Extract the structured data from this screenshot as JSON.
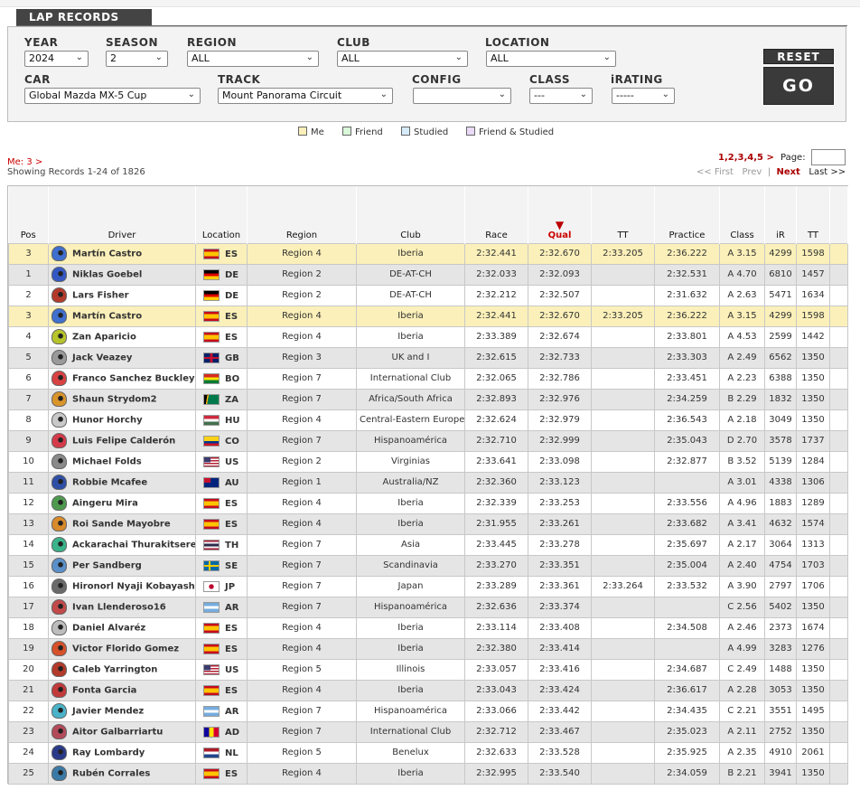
{
  "header": {
    "title": "LAP RECORDS"
  },
  "filters": {
    "year_label": "YEAR",
    "year_value": "2024",
    "season_label": "SEASON",
    "season_value": "2",
    "region_label": "REGION",
    "region_value": "ALL",
    "club_label": "CLUB",
    "club_value": "ALL",
    "location_label": "LOCATION",
    "location_value": "ALL",
    "car_label": "CAR",
    "car_value": "Global Mazda MX-5 Cup",
    "track_label": "TRACK",
    "track_value": "Mount Panorama Circuit",
    "config_label": "CONFIG",
    "config_value": "",
    "class_label": "CLASS",
    "class_value": "---",
    "irating_label": "iRATING",
    "irating_value": "-----",
    "reset_label": "RESET",
    "go_label": "GO"
  },
  "legend": [
    {
      "label": "Me",
      "color": "#fbf0b9"
    },
    {
      "label": "Friend",
      "color": "#d9f7d9"
    },
    {
      "label": "Studied",
      "color": "#d6ebfb"
    },
    {
      "label": "Friend & Studied",
      "color": "#ead9f7"
    }
  ],
  "info": {
    "me_link": "Me: 3 >",
    "showing": "Showing Records 1-24 of 1826",
    "pages": "1,2,3,4,5 >",
    "page_label": "Page:",
    "first": "<< First",
    "prev": "Prev",
    "sep": "|",
    "next": "Next",
    "last": "Last >>"
  },
  "columns": [
    "Pos",
    "Driver",
    "Location",
    "Region",
    "Club",
    "Race",
    "Qual",
    "TT",
    "Practice",
    "Class",
    "iR",
    "TT"
  ],
  "rows": [
    {
      "pos": "3",
      "driver": "Martín Castro",
      "loc": "ES",
      "region": "Region 4",
      "club": "Iberia",
      "race": "2:32.441",
      "qual": "2:32.670",
      "tt": "2:33.205",
      "practice": "2:36.222",
      "class": "A 3.15",
      "ir": "4299",
      "tt2": "1598",
      "me": true,
      "helmet": "#3f6fcf",
      "flag": "es"
    },
    {
      "pos": "1",
      "driver": "Niklas Goebel",
      "loc": "DE",
      "region": "Region 2",
      "club": "DE-AT-CH",
      "race": "2:32.033",
      "qual": "2:32.093",
      "tt": "",
      "practice": "2:32.531",
      "class": "A 4.70",
      "ir": "6810",
      "tt2": "1457",
      "helmet": "#3358c4",
      "flag": "de"
    },
    {
      "pos": "2",
      "driver": "Lars Fisher",
      "loc": "DE",
      "region": "Region 2",
      "club": "DE-AT-CH",
      "race": "2:32.212",
      "qual": "2:32.507",
      "tt": "",
      "practice": "2:31.632",
      "class": "A 2.63",
      "ir": "5471",
      "tt2": "1634",
      "helmet": "#b33a2a",
      "flag": "de"
    },
    {
      "pos": "3",
      "driver": "Martín Castro",
      "loc": "ES",
      "region": "Region 4",
      "club": "Iberia",
      "race": "2:32.441",
      "qual": "2:32.670",
      "tt": "2:33.205",
      "practice": "2:36.222",
      "class": "A 3.15",
      "ir": "4299",
      "tt2": "1598",
      "me": true,
      "helmet": "#3f6fcf",
      "flag": "es"
    },
    {
      "pos": "4",
      "driver": "Zan Aparicio",
      "loc": "ES",
      "region": "Region 4",
      "club": "Iberia",
      "race": "2:33.389",
      "qual": "2:32.674",
      "tt": "",
      "practice": "2:33.801",
      "class": "A 4.53",
      "ir": "2599",
      "tt2": "1442",
      "helmet": "#b7c42a",
      "flag": "es"
    },
    {
      "pos": "5",
      "driver": "Jack Veazey",
      "loc": "GB",
      "region": "Region 3",
      "club": "UK and I",
      "race": "2:32.615",
      "qual": "2:32.733",
      "tt": "",
      "practice": "2:33.303",
      "class": "A 2.49",
      "ir": "6562",
      "tt2": "1350",
      "helmet": "#9a9a9a",
      "flag": "gb"
    },
    {
      "pos": "6",
      "driver": "Franco Sanchez Buckley",
      "loc": "BO",
      "region": "Region 7",
      "club": "International Club",
      "race": "2:32.065",
      "qual": "2:32.786",
      "tt": "",
      "practice": "2:33.451",
      "class": "A 2.23",
      "ir": "6388",
      "tt2": "1350",
      "helmet": "#d94242",
      "flag": "bo"
    },
    {
      "pos": "7",
      "driver": "Shaun Strydom2",
      "loc": "ZA",
      "region": "Region 7",
      "club": "Africa/South Africa",
      "race": "2:32.893",
      "qual": "2:32.976",
      "tt": "",
      "practice": "2:34.259",
      "class": "B 2.29",
      "ir": "1832",
      "tt2": "1350",
      "helmet": "#d9952a",
      "flag": "za"
    },
    {
      "pos": "8",
      "driver": "Hunor Horchy",
      "loc": "HU",
      "region": "Region 4",
      "club": "Central-Eastern Europe",
      "race": "2:32.624",
      "qual": "2:32.979",
      "tt": "",
      "practice": "2:36.543",
      "class": "A 2.18",
      "ir": "3049",
      "tt2": "1350",
      "helmet": "#c8c8c8",
      "flag": "hu"
    },
    {
      "pos": "9",
      "driver": "Luis Felipe Calderón",
      "loc": "CO",
      "region": "Region 7",
      "club": "Hispanoamérica",
      "race": "2:32.710",
      "qual": "2:32.999",
      "tt": "",
      "practice": "2:35.043",
      "class": "D 2.70",
      "ir": "3578",
      "tt2": "1737",
      "helmet": "#d43a4a",
      "flag": "co"
    },
    {
      "pos": "10",
      "driver": "Michael Folds",
      "loc": "US",
      "region": "Region 2",
      "club": "Virginias",
      "race": "2:33.641",
      "qual": "2:33.098",
      "tt": "",
      "practice": "2:32.877",
      "class": "B 3.52",
      "ir": "5139",
      "tt2": "1284",
      "helmet": "#8a8a8a",
      "flag": "us"
    },
    {
      "pos": "11",
      "driver": "Robbie Mcafee",
      "loc": "AU",
      "region": "Region 1",
      "club": "Australia/NZ",
      "race": "2:32.360",
      "qual": "2:33.123",
      "tt": "",
      "practice": "",
      "class": "A 3.01",
      "ir": "4338",
      "tt2": "1306",
      "helmet": "#2f4fa6",
      "flag": "au"
    },
    {
      "pos": "12",
      "driver": "Aingeru Mira",
      "loc": "ES",
      "region": "Region 4",
      "club": "Iberia",
      "race": "2:32.339",
      "qual": "2:33.253",
      "tt": "",
      "practice": "2:33.556",
      "class": "A 4.96",
      "ir": "1883",
      "tt2": "1289",
      "helmet": "#4f9a4f",
      "flag": "es"
    },
    {
      "pos": "13",
      "driver": "Roi Sande Mayobre",
      "loc": "ES",
      "region": "Region 4",
      "club": "Iberia",
      "race": "2:31.955",
      "qual": "2:33.261",
      "tt": "",
      "practice": "2:33.682",
      "class": "A 3.41",
      "ir": "4632",
      "tt2": "1574",
      "helmet": "#d98a2a",
      "flag": "es"
    },
    {
      "pos": "14",
      "driver": "Ackarachai Thurakitseree",
      "loc": "TH",
      "region": "Region 7",
      "club": "Asia",
      "race": "2:33.445",
      "qual": "2:33.278",
      "tt": "",
      "practice": "2:35.697",
      "class": "A 2.17",
      "ir": "3064",
      "tt2": "1313",
      "helmet": "#3ab38a",
      "flag": "th"
    },
    {
      "pos": "15",
      "driver": "Per Sandberg",
      "loc": "SE",
      "region": "Region 7",
      "club": "Scandinavia",
      "race": "2:33.270",
      "qual": "2:33.351",
      "tt": "",
      "practice": "2:35.004",
      "class": "A 2.40",
      "ir": "4754",
      "tt2": "1703",
      "helmet": "#5a8fc9",
      "flag": "se"
    },
    {
      "pos": "16",
      "driver": "Hironorl Nyaji Kobayashi",
      "loc": "JP",
      "region": "Region 7",
      "club": "Japan",
      "race": "2:33.289",
      "qual": "2:33.361",
      "tt": "2:33.264",
      "practice": "2:33.532",
      "class": "A 3.90",
      "ir": "2797",
      "tt2": "1706",
      "helmet": "#6a6a6a",
      "flag": "jp"
    },
    {
      "pos": "17",
      "driver": "Ivan Llenderoso16",
      "loc": "AR",
      "region": "Region 7",
      "club": "Hispanoamérica",
      "race": "2:32.636",
      "qual": "2:33.374",
      "tt": "",
      "practice": "",
      "class": "C 2.56",
      "ir": "5402",
      "tt2": "1350",
      "helmet": "#c24a4a",
      "flag": "ar"
    },
    {
      "pos": "18",
      "driver": "Daniel Alvaréz",
      "loc": "ES",
      "region": "Region 4",
      "club": "Iberia",
      "race": "2:33.114",
      "qual": "2:33.408",
      "tt": "",
      "practice": "2:34.508",
      "class": "A 2.46",
      "ir": "2373",
      "tt2": "1674",
      "helmet": "#bdbdbd",
      "flag": "es"
    },
    {
      "pos": "19",
      "driver": "Victor Florido Gomez",
      "loc": "ES",
      "region": "Region 4",
      "club": "Iberia",
      "race": "2:32.380",
      "qual": "2:33.414",
      "tt": "",
      "practice": "",
      "class": "A 4.99",
      "ir": "3283",
      "tt2": "1276",
      "helmet": "#d6502a",
      "flag": "es"
    },
    {
      "pos": "20",
      "driver": "Caleb Yarrington",
      "loc": "US",
      "region": "Region 5",
      "club": "Illinois",
      "race": "2:33.057",
      "qual": "2:33.416",
      "tt": "",
      "practice": "2:34.687",
      "class": "C 2.49",
      "ir": "1488",
      "tt2": "1350",
      "helmet": "#b33a2a",
      "flag": "us"
    },
    {
      "pos": "21",
      "driver": "Fonta Garcia",
      "loc": "ES",
      "region": "Region 4",
      "club": "Iberia",
      "race": "2:33.043",
      "qual": "2:33.424",
      "tt": "",
      "practice": "2:36.617",
      "class": "A 2.28",
      "ir": "3053",
      "tt2": "1350",
      "helmet": "#c23a3a",
      "flag": "es"
    },
    {
      "pos": "22",
      "driver": "Javier Mendez",
      "loc": "AR",
      "region": "Region 7",
      "club": "Hispanoamérica",
      "race": "2:33.066",
      "qual": "2:33.442",
      "tt": "",
      "practice": "2:34.435",
      "class": "C 2.21",
      "ir": "3551",
      "tt2": "1495",
      "helmet": "#4ab3c9",
      "flag": "ar"
    },
    {
      "pos": "23",
      "driver": "Aitor Galbarriartu",
      "loc": "AD",
      "region": "Region 7",
      "club": "International Club",
      "race": "2:32.712",
      "qual": "2:33.467",
      "tt": "",
      "practice": "2:35.023",
      "class": "A 2.11",
      "ir": "2752",
      "tt2": "1350",
      "helmet": "#b34a5a",
      "flag": "ad"
    },
    {
      "pos": "24",
      "driver": "Ray Lombardy",
      "loc": "NL",
      "region": "Region 5",
      "club": "Benelux",
      "race": "2:32.633",
      "qual": "2:33.528",
      "tt": "",
      "practice": "2:35.925",
      "class": "A 2.35",
      "ir": "4910",
      "tt2": "2061",
      "helmet": "#2a3a8a",
      "flag": "nl"
    },
    {
      "pos": "25",
      "driver": "Rubén Corrales",
      "loc": "ES",
      "region": "Region 4",
      "club": "Iberia",
      "race": "2:32.995",
      "qual": "2:33.540",
      "tt": "",
      "practice": "2:34.059",
      "class": "B 2.21",
      "ir": "3941",
      "tt2": "1350",
      "helmet": "#3a7aa6",
      "flag": "es"
    }
  ]
}
